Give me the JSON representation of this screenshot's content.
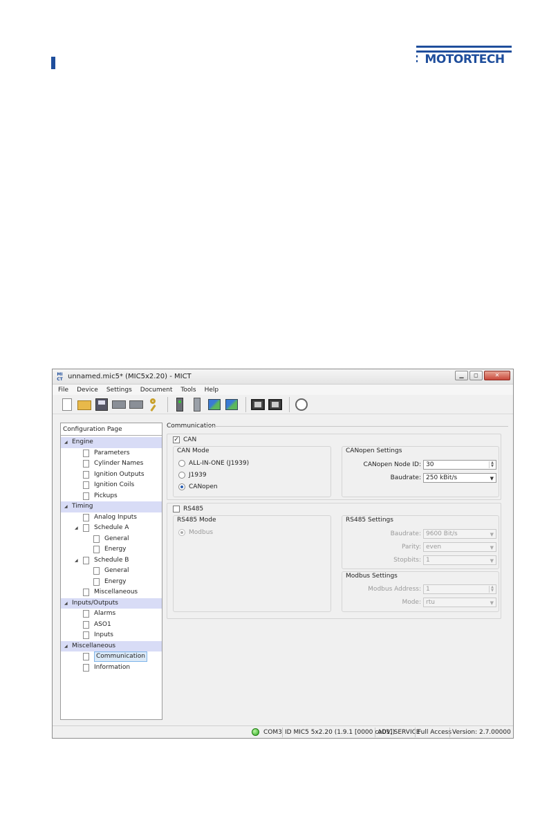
{
  "logo": {
    "text": "MOTORTECH"
  },
  "window": {
    "title": "unnamed.mic5* (MIC5x2.20) - MICT",
    "app_icon": "MI CT"
  },
  "menu": [
    "File",
    "Device",
    "Settings",
    "Document",
    "Tools",
    "Help"
  ],
  "toolbar_icons": [
    "new-document-icon",
    "open-folder-icon",
    "save-icon",
    "print-icon",
    "print-setup-icon",
    "key-icon",
    "device-connect-icon",
    "device-disconnect-icon",
    "network-read-icon",
    "network-write-icon",
    "monitor-icon",
    "display-icon",
    "gauge-icon"
  ],
  "tree": {
    "header": "Configuration Page",
    "items": [
      {
        "label": "Engine",
        "kind": "group"
      },
      {
        "label": "Parameters",
        "kind": "page",
        "indent": 1
      },
      {
        "label": "Cylinder Names",
        "kind": "page",
        "indent": 1
      },
      {
        "label": "Ignition Outputs",
        "kind": "page",
        "indent": 1
      },
      {
        "label": "Ignition Coils",
        "kind": "page",
        "indent": 1
      },
      {
        "label": "Pickups",
        "kind": "page",
        "indent": 1
      },
      {
        "label": "Timing",
        "kind": "group"
      },
      {
        "label": "Analog Inputs",
        "kind": "page",
        "indent": 1
      },
      {
        "label": "Schedule A",
        "kind": "folder",
        "indent": 1
      },
      {
        "label": "General",
        "kind": "page",
        "indent": 2
      },
      {
        "label": "Energy",
        "kind": "page",
        "indent": 2
      },
      {
        "label": "Schedule B",
        "kind": "folder",
        "indent": 1
      },
      {
        "label": "General",
        "kind": "page",
        "indent": 2
      },
      {
        "label": "Energy",
        "kind": "page",
        "indent": 2
      },
      {
        "label": "Miscellaneous",
        "kind": "page",
        "indent": 1
      },
      {
        "label": "Inputs/Outputs",
        "kind": "group"
      },
      {
        "label": "Alarms",
        "kind": "page",
        "indent": 1
      },
      {
        "label": "ASO1",
        "kind": "page",
        "indent": 1
      },
      {
        "label": "Inputs",
        "kind": "page",
        "indent": 1
      },
      {
        "label": "Miscellaneous",
        "kind": "group"
      },
      {
        "label": "Communication",
        "kind": "page",
        "indent": 1,
        "selected": true
      },
      {
        "label": "Information",
        "kind": "page",
        "indent": 1
      }
    ]
  },
  "communication": {
    "section_title": "Communication",
    "can": {
      "checkbox_label": "CAN",
      "checked": true,
      "mode_group": "CAN Mode",
      "modes": [
        {
          "label": "ALL-IN-ONE (J1939)",
          "selected": false
        },
        {
          "label": "J1939",
          "selected": false
        },
        {
          "label": "CANopen",
          "selected": true
        }
      ],
      "settings_group": "CANopen Settings",
      "node_id_label": "CANopen Node ID:",
      "node_id_value": "30",
      "baudrate_label": "Baudrate:",
      "baudrate_value": "250 kBit/s"
    },
    "rs485": {
      "checkbox_label": "RS485",
      "checked": false,
      "mode_group": "RS485 Mode",
      "mode_label": "Modbus",
      "settings_group": "RS485 Settings",
      "baudrate_label": "Baudrate:",
      "baudrate_value": "9600 Bit/s",
      "parity_label": "Parity:",
      "parity_value": "even",
      "stopbits_label": "Stopbits:",
      "stopbits_value": "1",
      "modbus_group": "Modbus Settings",
      "address_label": "Modbus Address:",
      "address_value": "1",
      "mode_field_label": "Mode:",
      "mode_field_value": "rtu"
    }
  },
  "status": {
    "port": "COM3",
    "device": "ID MIC5 5x2.20 (1.9.1 [0000 ca01])",
    "role": "ADV. SERVICE",
    "access": "Full Access",
    "version": "Version: 2.7.00000"
  }
}
